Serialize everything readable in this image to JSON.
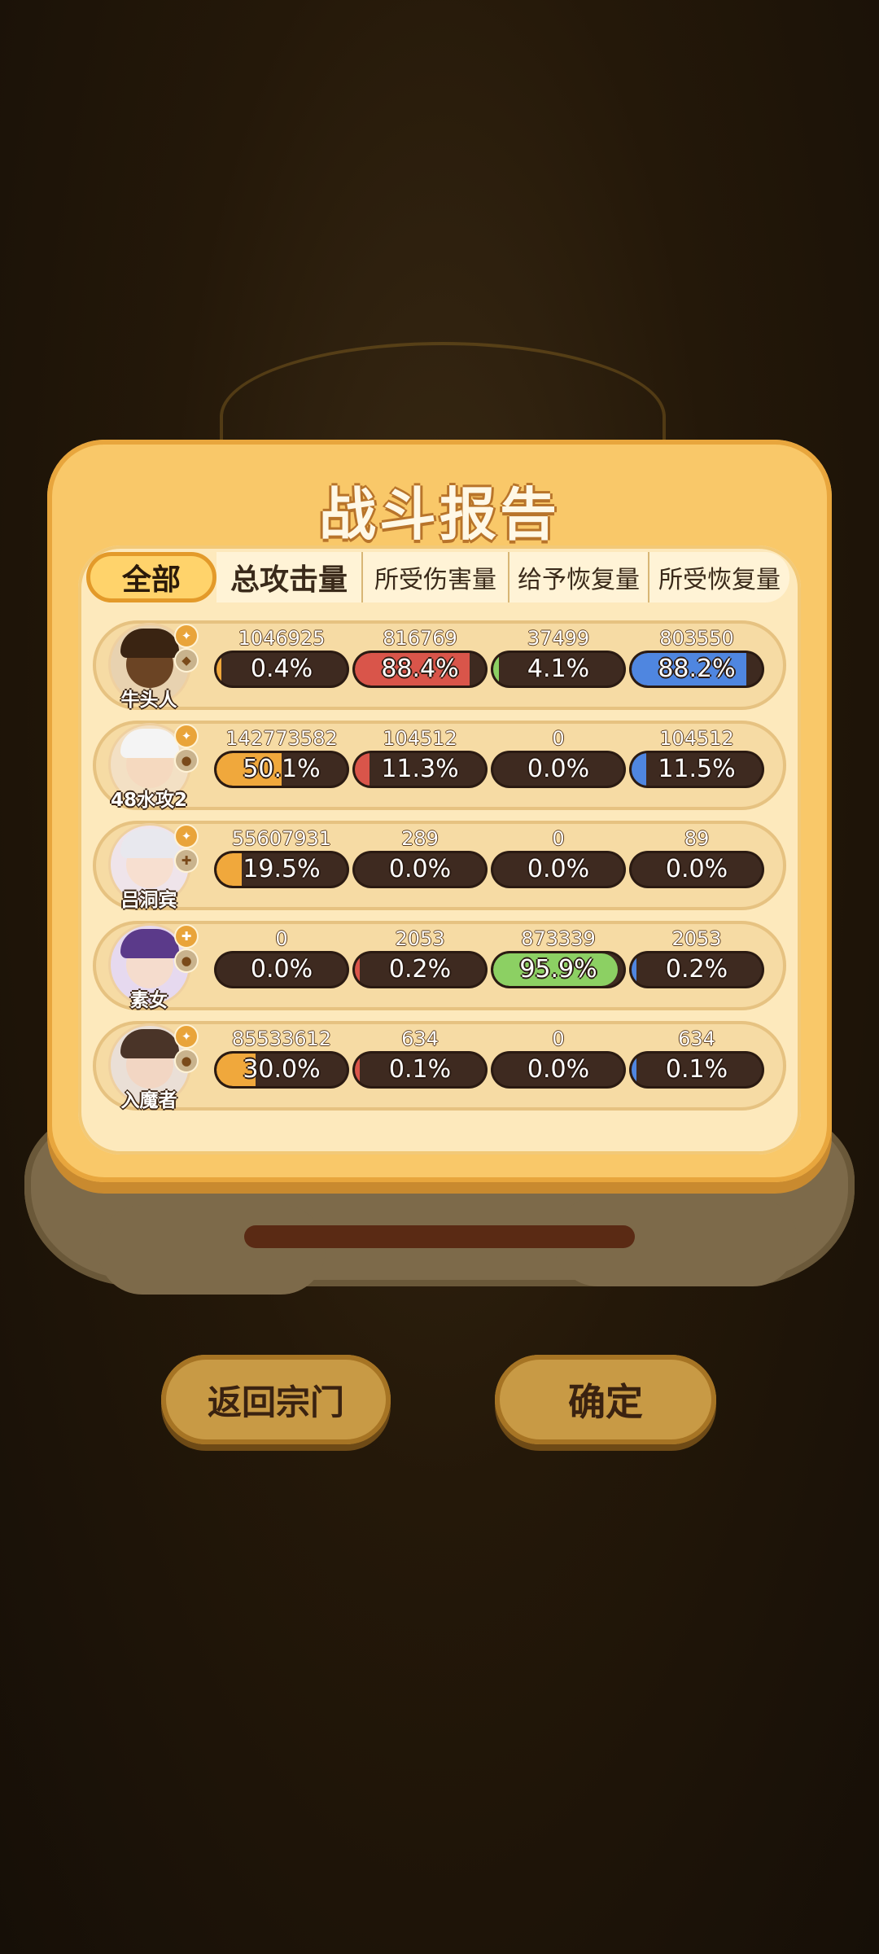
{
  "panel": {
    "title": "战斗报告",
    "tabs": [
      "全部",
      "总攻击量",
      "所受伤害量",
      "给予恢复量",
      "所受恢复量"
    ]
  },
  "heroes": [
    {
      "name": "牛头人",
      "stats": [
        {
          "value": "1046925",
          "pct": "0.4%",
          "fill": 0.004,
          "color": "#f0a83c"
        },
        {
          "value": "816769",
          "pct": "88.4%",
          "fill": 0.884,
          "color": "#d9554a"
        },
        {
          "value": "37499",
          "pct": "4.1%",
          "fill": 0.041,
          "color": "#8cd063"
        },
        {
          "value": "803550",
          "pct": "88.2%",
          "fill": 0.882,
          "color": "#4f86e0"
        }
      ]
    },
    {
      "name": "48水攻2",
      "stats": [
        {
          "value": "142773582",
          "pct": "50.1%",
          "fill": 0.501,
          "color": "#f0a83c"
        },
        {
          "value": "104512",
          "pct": "11.3%",
          "fill": 0.113,
          "color": "#d9554a"
        },
        {
          "value": "0",
          "pct": "0.0%",
          "fill": 0,
          "color": "#8cd063"
        },
        {
          "value": "104512",
          "pct": "11.5%",
          "fill": 0.115,
          "color": "#4f86e0"
        }
      ]
    },
    {
      "name": "吕洞宾",
      "stats": [
        {
          "value": "55607931",
          "pct": "19.5%",
          "fill": 0.195,
          "color": "#f0a83c"
        },
        {
          "value": "289",
          "pct": "0.0%",
          "fill": 0,
          "color": "#d9554a"
        },
        {
          "value": "0",
          "pct": "0.0%",
          "fill": 0,
          "color": "#8cd063"
        },
        {
          "value": "89",
          "pct": "0.0%",
          "fill": 0,
          "color": "#4f86e0"
        }
      ]
    },
    {
      "name": "素女",
      "stats": [
        {
          "value": "0",
          "pct": "0.0%",
          "fill": 0,
          "color": "#f0a83c"
        },
        {
          "value": "2053",
          "pct": "0.2%",
          "fill": 0.002,
          "color": "#d9554a"
        },
        {
          "value": "873339",
          "pct": "95.9%",
          "fill": 0.959,
          "color": "#8cd063"
        },
        {
          "value": "2053",
          "pct": "0.2%",
          "fill": 0.002,
          "color": "#4f86e0"
        }
      ]
    },
    {
      "name": "入魔者",
      "stats": [
        {
          "value": "85533612",
          "pct": "30.0%",
          "fill": 0.3,
          "color": "#f0a83c"
        },
        {
          "value": "634",
          "pct": "0.1%",
          "fill": 0.001,
          "color": "#d9554a"
        },
        {
          "value": "0",
          "pct": "0.0%",
          "fill": 0,
          "color": "#8cd063"
        },
        {
          "value": "634",
          "pct": "0.1%",
          "fill": 0.001,
          "color": "#4f86e0"
        }
      ]
    }
  ],
  "buttons": {
    "back_label": "返回宗门",
    "confirm_label": "确定"
  }
}
